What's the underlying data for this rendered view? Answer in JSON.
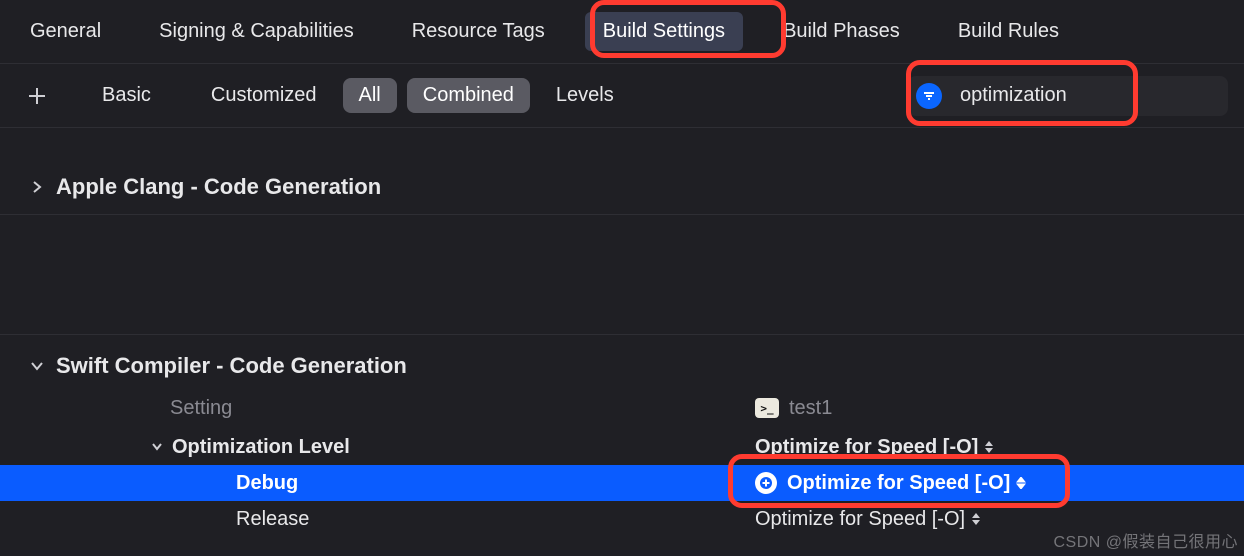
{
  "tabs": {
    "general": "General",
    "signing": "Signing & Capabilities",
    "resource_tags": "Resource Tags",
    "build_settings": "Build Settings",
    "build_phases": "Build Phases",
    "build_rules": "Build Rules"
  },
  "filter": {
    "basic": "Basic",
    "customized": "Customized",
    "all": "All",
    "combined": "Combined",
    "levels": "Levels",
    "search_value": "optimization"
  },
  "sections": {
    "clang": "Apple Clang - Code Generation",
    "swift": "Swift Compiler - Code Generation",
    "setting_header": "Setting",
    "target_name": "test1",
    "opt_level": "Optimization Level",
    "debug": "Debug",
    "release": "Release",
    "opt_speed": "Optimize for Speed [-O]"
  },
  "watermark": "CSDN @假装自己很用心"
}
